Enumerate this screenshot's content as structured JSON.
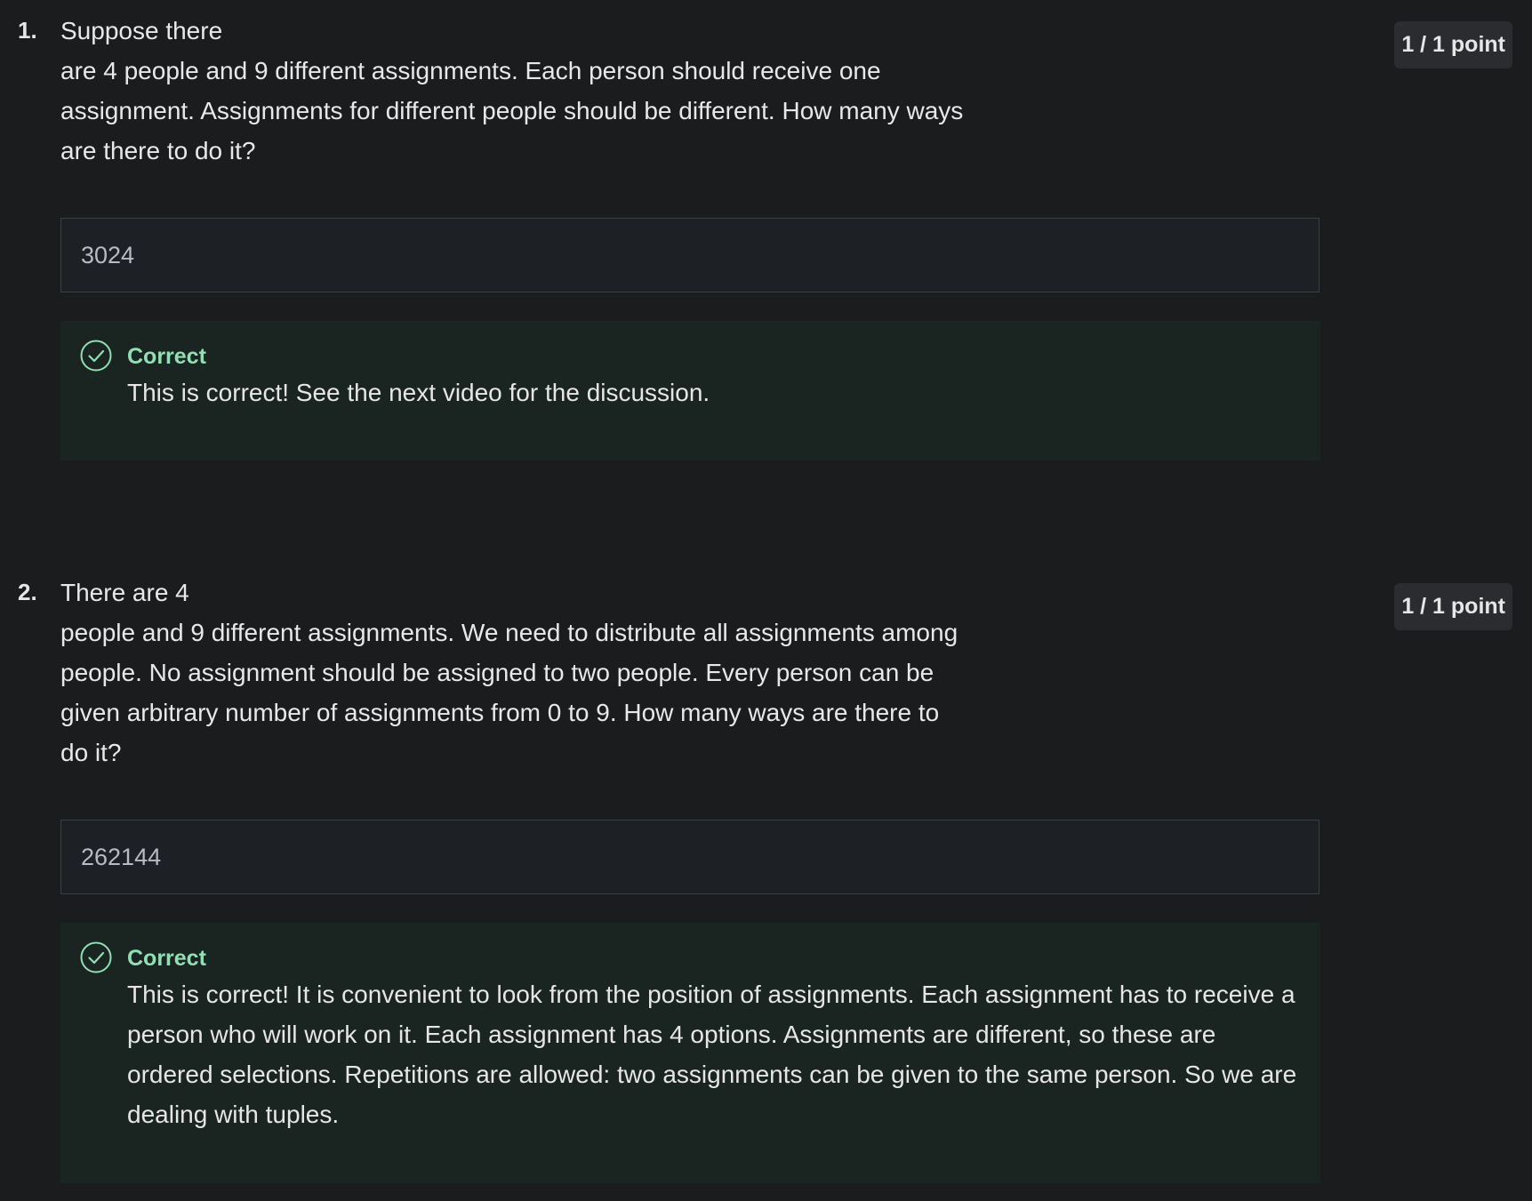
{
  "questions": [
    {
      "number": "1.",
      "text_lines": [
        "Suppose there",
        "are 4 people and 9 different assignments. Each person should receive one",
        "assignment. Assignments for different people should be different. How many ways",
        "are there to do it?"
      ],
      "points": "1 / 1 point",
      "answer_value": "3024",
      "feedback": {
        "status": "Correct",
        "message_lines": [
          "This is correct! See the next video for the discussion."
        ]
      }
    },
    {
      "number": "2.",
      "text_lines": [
        "There are 4",
        "people and 9 different assignments. We need to distribute all assignments among",
        "people. No assignment should be assigned to two people. Every person can be",
        "given arbitrary number of assignments from 0 to 9. How many ways are there to",
        "do it?"
      ],
      "points": "1 / 1 point",
      "answer_value": "262144",
      "feedback": {
        "status": "Correct",
        "message_lines": [
          "This is correct! It is convenient to look from the position of assignments. Each assignment has to receive a",
          "person who will work on it. Each assignment has 4 options. Assignments are different, so these are",
          "ordered selections. Repetitions are allowed: two assignments can be given to the same person. So we are",
          "dealing with tuples."
        ]
      }
    }
  ],
  "colors": {
    "background": "#1b1c1e",
    "feedback_bg": "#1a2420",
    "correct_accent": "#8fe0b4",
    "input_bg": "#1d2126"
  },
  "icons": {
    "feedback": "check-circle-icon"
  }
}
